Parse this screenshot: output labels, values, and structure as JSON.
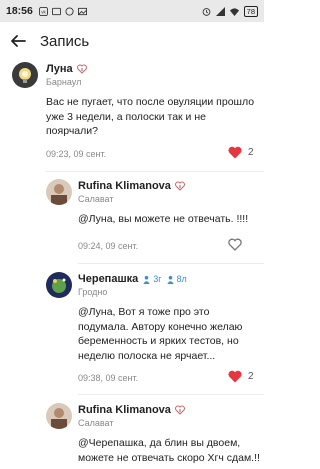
{
  "status_bar": {
    "time": "18:56",
    "battery": "78"
  },
  "app_bar": {
    "title": "Запись"
  },
  "posts": [
    {
      "author": "Луна",
      "city": "Барнаул",
      "text": "Вас не пугает, что после овуляции прошло уже 3 недели, а полоски так и не поярчали?",
      "time": "09:23, 09 сент.",
      "likes": "2",
      "liked": true
    },
    {
      "author": "Rufina Klimanova",
      "city": "Салават",
      "text": "@Луна, вы можете не отвечать. !!!!",
      "time": "09:24, 09 сент.",
      "likes": "",
      "liked": false
    },
    {
      "author": "Черепашка",
      "chips": [
        "3г",
        "8л"
      ],
      "city": "Гродно",
      "text": "@Луна, Вот я тоже про это подумала. Автору конечно желаю беременность и ярких тестов, но неделю полоска не ярчает...",
      "time": "09:38, 09 сент.",
      "likes": "2",
      "liked": true
    },
    {
      "author": "Rufina Klimanova",
      "city": "Салават",
      "text": "@Черепашка, да блин вы двоем, можете не отвечать скоро Хгч сдам.!!",
      "time": "",
      "likes": "",
      "liked": false
    }
  ],
  "colors": {
    "heart": "#e8353f",
    "link": "#3b8fd9",
    "meta": "#888888"
  }
}
